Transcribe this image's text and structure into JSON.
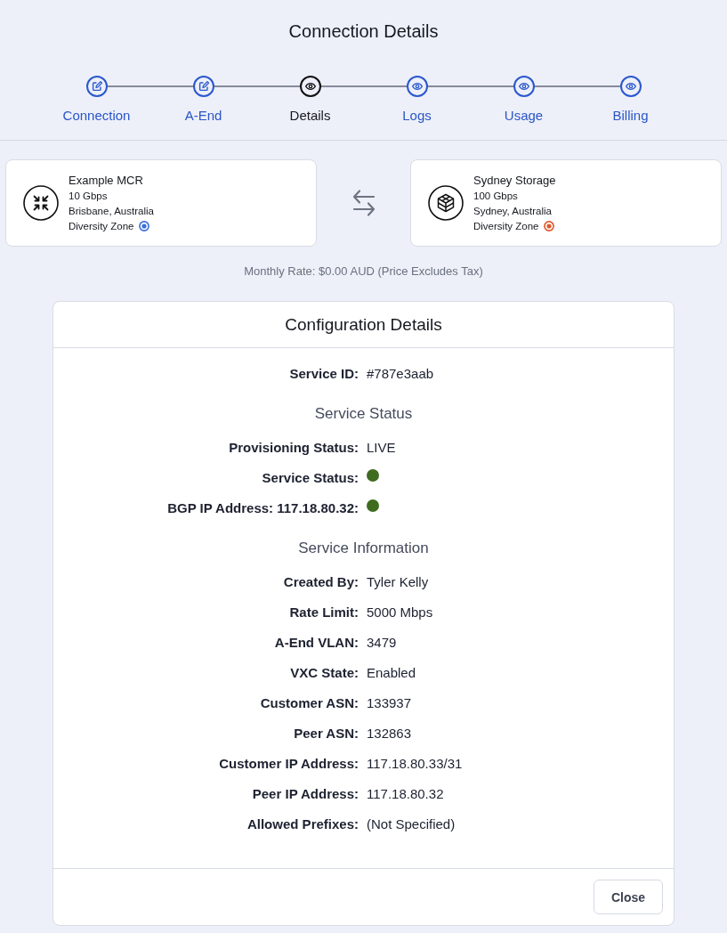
{
  "title": "Connection Details",
  "steps": [
    {
      "label": "Connection",
      "completed": true,
      "selected": false
    },
    {
      "label": "A-End",
      "completed": true,
      "selected": false
    },
    {
      "label": "Details",
      "completed": false,
      "selected": true
    },
    {
      "label": "Logs",
      "completed": false,
      "selected": false
    },
    {
      "label": "Usage",
      "completed": false,
      "selected": false
    },
    {
      "label": "Billing",
      "completed": false,
      "selected": false
    }
  ],
  "endpoints": [
    {
      "kind": "mcr",
      "name": "Example MCR",
      "speed": "10 Gbps",
      "location": "Brisbane, Australia",
      "zone": {
        "label": "Diversity Zone",
        "color": "#3b6fe0"
      }
    },
    {
      "kind": "storage",
      "name": "Sydney Storage",
      "speed": "100 Gbps",
      "location": "Sydney, Australia",
      "zone": {
        "label": "Diversity Zone",
        "color": "#e0582a"
      }
    }
  ],
  "monthly_rate": "Monthly Rate: $0.00 AUD (Price Excludes Tax)",
  "configuration": {
    "title": "Configuration Details",
    "service_id": {
      "label": "Service ID:",
      "value": "#787e3aab"
    },
    "sections": [
      {
        "heading": "Service Status",
        "rows": [
          {
            "kind": "text",
            "label": "Provisioning Status:",
            "value": "LIVE"
          },
          {
            "kind": "status",
            "label": "Service Status:",
            "color": "#3f6b1f"
          },
          {
            "kind": "status",
            "label": "BGP IP Address: 117.18.80.32:",
            "color": "#3f6b1f"
          }
        ]
      },
      {
        "heading": "Service Information",
        "rows": [
          {
            "kind": "text",
            "label": "Created By:",
            "value": "Tyler Kelly"
          },
          {
            "kind": "text",
            "label": "Rate Limit:",
            "value": "5000 Mbps"
          },
          {
            "kind": "text",
            "label": "A-End VLAN:",
            "value": "3479"
          },
          {
            "kind": "text",
            "label": "VXC State:",
            "value": "Enabled"
          },
          {
            "kind": "text",
            "label": "Customer ASN:",
            "value": "133937"
          },
          {
            "kind": "text",
            "label": "Peer ASN:",
            "value": "132863"
          },
          {
            "kind": "text",
            "label": "Customer IP Address:",
            "value": "117.18.80.33/31"
          },
          {
            "kind": "text",
            "label": "Peer IP Address:",
            "value": "117.18.80.32"
          },
          {
            "kind": "text",
            "label": "Allowed Prefixes:",
            "value": "(Not Specified)"
          }
        ]
      }
    ]
  },
  "buttons": [
    {
      "label": "Close"
    }
  ]
}
